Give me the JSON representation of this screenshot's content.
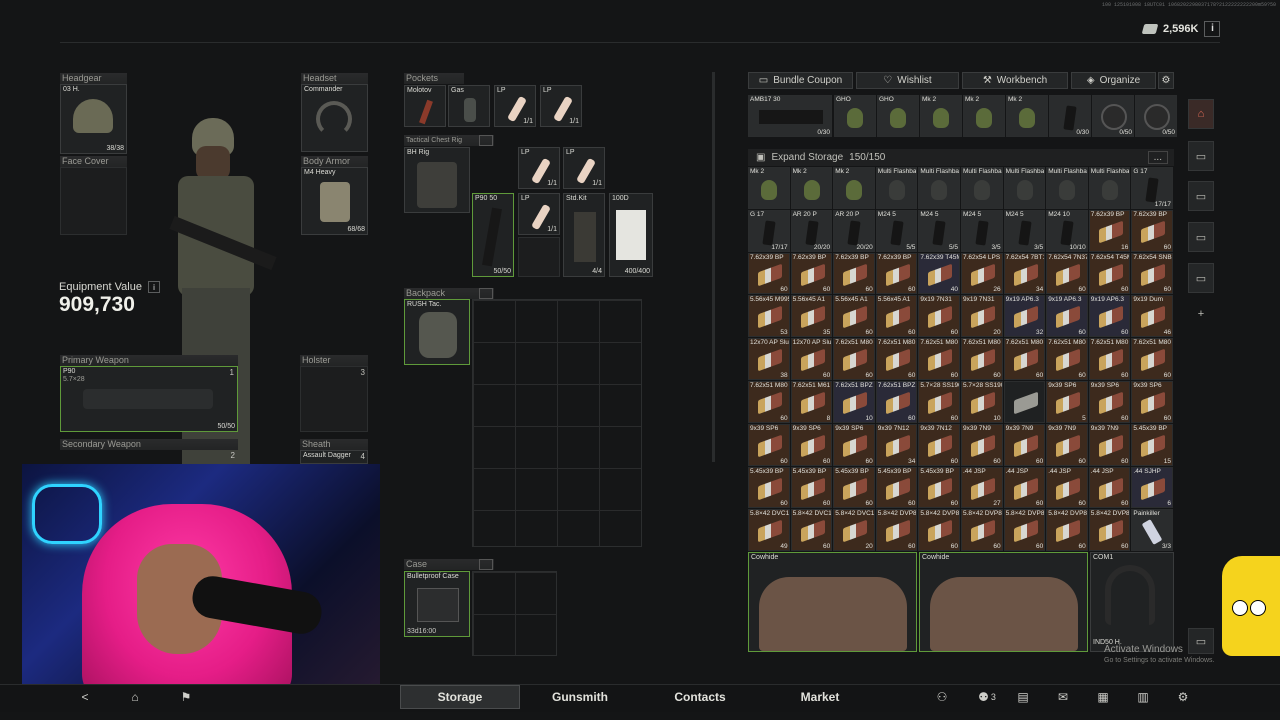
{
  "header": {
    "micro_text": "100 125101008 18UTC01 1068202298037178?2122222222200m59?50",
    "money": "2,596K",
    "info": "i"
  },
  "equipment": {
    "headgear": {
      "label": "Headgear",
      "item": "03 H.",
      "count": "38/38",
      "level": "5"
    },
    "headset": {
      "label": "Headset",
      "item": "Commander"
    },
    "face_cover": {
      "label": "Face Cover"
    },
    "body_armor": {
      "label": "Body Armor",
      "item": "M4 Heavy",
      "count": "68/68",
      "level": "5"
    },
    "value_label": "Equipment Value",
    "value": "909,730",
    "primary": {
      "label": "Primary Weapon",
      "item": "P90",
      "sub": "5.7×28",
      "count": "50/50",
      "slot": "1"
    },
    "holster": {
      "label": "Holster",
      "slot": "3"
    },
    "secondary": {
      "label": "Secondary Weapon",
      "slot": "2"
    },
    "sheath": {
      "label": "Sheath",
      "item": "Assault Dagger",
      "slot": "4"
    }
  },
  "pockets": {
    "label": "Pockets",
    "items": [
      {
        "name": "Molotov",
        "count": ""
      },
      {
        "name": "Gas",
        "count": ""
      },
      {
        "name": "LP",
        "count": "1/1"
      },
      {
        "name": "LP",
        "count": "1/1"
      }
    ]
  },
  "rig": {
    "label": "Tactical Chest Rig",
    "item": "BH Rig",
    "slots": [
      {
        "name": "LP",
        "count": "1/1"
      },
      {
        "name": "LP",
        "count": "1/1"
      },
      {
        "name": "P90 50",
        "count": "50/50"
      },
      {
        "name": "LP",
        "count": "1/1"
      },
      {
        "name": "Std.Kit",
        "count": "4/4"
      },
      {
        "name": "100D",
        "count": "400/400"
      }
    ]
  },
  "backpack": {
    "label": "Backpack",
    "item": "RUSH Tac."
  },
  "case": {
    "label": "Case",
    "item": "Bulletproof Case",
    "timer": "33d16:00"
  },
  "stash_tabs": [
    {
      "label": "Bundle Coupon",
      "icon": "coupon-icon"
    },
    {
      "label": "Wishlist",
      "icon": "heart-icon"
    },
    {
      "label": "Workbench",
      "icon": "wrench-icon"
    },
    {
      "label": "Organize",
      "icon": "organize-icon"
    }
  ],
  "top_row": [
    {
      "name": "AMB17 30",
      "count": "0/30",
      "red": true
    },
    {
      "name": "GHO",
      "count": ""
    },
    {
      "name": "GHO",
      "count": ""
    },
    {
      "name": "Mk 2",
      "count": ""
    },
    {
      "name": "Mk 2",
      "count": ""
    },
    {
      "name": "Mk 2",
      "count": ""
    },
    {
      "name": "",
      "count": "0/30",
      "red": true
    },
    {
      "name": "",
      "count": "0/50",
      "red": true
    },
    {
      "name": "",
      "count": "0/50",
      "red": true
    }
  ],
  "stash": {
    "title": "Expand Storage",
    "capacity": "150/150",
    "more": "...",
    "rows": [
      [
        {
          "n": "Mk 2",
          "c": "",
          "t": "g"
        },
        {
          "n": "Mk 2",
          "c": "",
          "t": "g"
        },
        {
          "n": "Mk 2",
          "c": "",
          "t": "g"
        },
        {
          "n": "Multi Flashbang",
          "c": "",
          "t": "f"
        },
        {
          "n": "Multi Flashbang",
          "c": "",
          "t": "f"
        },
        {
          "n": "Multi Flashbang",
          "c": "",
          "t": "f"
        },
        {
          "n": "Multi Flashbang",
          "c": "",
          "t": "f"
        },
        {
          "n": "Multi Flashbang",
          "c": "",
          "t": "f"
        },
        {
          "n": "Multi Flashbang",
          "c": "",
          "t": "f"
        },
        {
          "n": "G 17",
          "c": "17/17",
          "t": "m"
        }
      ],
      [
        {
          "n": "G 17",
          "c": "17/17",
          "t": "m"
        },
        {
          "n": "AR 20 P",
          "c": "20/20",
          "t": "m"
        },
        {
          "n": "AR 20 P",
          "c": "20/20",
          "t": "m"
        },
        {
          "n": "M24 5",
          "c": "5/5",
          "t": "m"
        },
        {
          "n": "M24 5",
          "c": "5/5",
          "t": "m"
        },
        {
          "n": "M24 5",
          "c": "3/5",
          "t": "m"
        },
        {
          "n": "M24 5",
          "c": "3/5",
          "t": "m"
        },
        {
          "n": "M24 10",
          "c": "10/10",
          "t": "m"
        },
        {
          "n": "7.62x39 BP",
          "c": "16",
          "t": "a"
        },
        {
          "n": "7.62x39 BP",
          "c": "60",
          "t": "a"
        }
      ],
      [
        {
          "n": "7.62x39 BP",
          "c": "60",
          "t": "a"
        },
        {
          "n": "7.62x39 BP",
          "c": "60",
          "t": "a"
        },
        {
          "n": "7.62x39 BP",
          "c": "60",
          "t": "a"
        },
        {
          "n": "7.62x39 BP",
          "c": "60",
          "t": "a"
        },
        {
          "n": "7.62x39 T45M",
          "c": "40",
          "t": "b"
        },
        {
          "n": "7.62x54 LPS",
          "c": "26",
          "t": "a"
        },
        {
          "n": "7.62x54 7BT1",
          "c": "34",
          "t": "a"
        },
        {
          "n": "7.62x54 7N37",
          "c": "60",
          "t": "a"
        },
        {
          "n": "7.62x54 T45M",
          "c": "60",
          "t": "a"
        },
        {
          "n": "7.62x54 SNB",
          "c": "60",
          "t": "a"
        }
      ],
      [
        {
          "n": "5.56x45 M995",
          "c": "53",
          "t": "a"
        },
        {
          "n": "5.56x45 A1",
          "c": "35",
          "t": "a"
        },
        {
          "n": "5.56x45 A1",
          "c": "60",
          "t": "a"
        },
        {
          "n": "5.56x45 A1",
          "c": "60",
          "t": "a"
        },
        {
          "n": "9x19 7N31",
          "c": "60",
          "t": "a"
        },
        {
          "n": "9x19 7N31",
          "c": "20",
          "t": "a"
        },
        {
          "n": "9x19 AP6.3",
          "c": "32",
          "t": "b"
        },
        {
          "n": "9x19 AP6.3",
          "c": "60",
          "t": "b"
        },
        {
          "n": "9x19 AP6.3",
          "c": "60",
          "t": "b"
        },
        {
          "n": "9x19 Dum",
          "c": "46",
          "t": "a"
        }
      ],
      [
        {
          "n": "12x70 AP Slugs",
          "c": "38",
          "t": "a"
        },
        {
          "n": "12x70 AP Slugs",
          "c": "60",
          "t": "a"
        },
        {
          "n": "7.62x51 M80",
          "c": "60",
          "t": "a"
        },
        {
          "n": "7.62x51 M80",
          "c": "60",
          "t": "a"
        },
        {
          "n": "7.62x51 M80",
          "c": "60",
          "t": "a"
        },
        {
          "n": "7.62x51 M80",
          "c": "60",
          "t": "a"
        },
        {
          "n": "7.62x51 M80",
          "c": "60",
          "t": "a"
        },
        {
          "n": "7.62x51 M80",
          "c": "60",
          "t": "a"
        },
        {
          "n": "7.62x51 M80",
          "c": "60",
          "t": "a"
        },
        {
          "n": "7.62x51 M80",
          "c": "60",
          "t": "a"
        }
      ],
      [
        {
          "n": "7.62x51 M80",
          "c": "60",
          "t": "a"
        },
        {
          "n": "7.62x51 M61",
          "c": "8",
          "t": "a"
        },
        {
          "n": "7.62x51 BPZ",
          "c": "10",
          "t": "b"
        },
        {
          "n": "7.62x51 BPZ",
          "c": "60",
          "t": "b"
        },
        {
          "n": "5.7×28 SS190",
          "c": "60",
          "t": "a"
        },
        {
          "n": "5.7×28 SS190",
          "c": "10",
          "t": "a"
        },
        {
          "n": "",
          "c": "",
          "t": "x"
        },
        {
          "n": "9x39 SP6",
          "c": "5",
          "t": "a"
        },
        {
          "n": "9x39 SP6",
          "c": "60",
          "t": "a"
        },
        {
          "n": "9x39 SP6",
          "c": "60",
          "t": "a"
        }
      ],
      [
        {
          "n": "9x39 SP6",
          "c": "60",
          "t": "a"
        },
        {
          "n": "9x39 SP6",
          "c": "60",
          "t": "a"
        },
        {
          "n": "9x39 SP6",
          "c": "60",
          "t": "a"
        },
        {
          "n": "9x39 7N12",
          "c": "34",
          "t": "a"
        },
        {
          "n": "9x39 7N12",
          "c": "60",
          "t": "a"
        },
        {
          "n": "9x39 7N9",
          "c": "60",
          "t": "a"
        },
        {
          "n": "9x39 7N9",
          "c": "60",
          "t": "a"
        },
        {
          "n": "9x39 7N9",
          "c": "60",
          "t": "a"
        },
        {
          "n": "9x39 7N9",
          "c": "60",
          "t": "a"
        },
        {
          "n": "5.45x39 BP",
          "c": "15",
          "t": "a"
        }
      ],
      [
        {
          "n": "5.45x39 BP",
          "c": "60",
          "t": "a"
        },
        {
          "n": "5.45x39 BP",
          "c": "60",
          "t": "a"
        },
        {
          "n": "5.45x39 BP",
          "c": "60",
          "t": "a"
        },
        {
          "n": "5.45x39 BP",
          "c": "60",
          "t": "a"
        },
        {
          "n": "5.45x39 BP",
          "c": "60",
          "t": "a"
        },
        {
          "n": ".44 JSP",
          "c": "27",
          "t": "a"
        },
        {
          "n": ".44 JSP",
          "c": "60",
          "t": "a"
        },
        {
          "n": ".44 JSP",
          "c": "60",
          "t": "a"
        },
        {
          "n": ".44 JSP",
          "c": "60",
          "t": "a"
        },
        {
          "n": ".44 SJHP",
          "c": "6",
          "t": "b"
        }
      ],
      [
        {
          "n": "5.8×42 DVC12",
          "c": "49",
          "t": "a"
        },
        {
          "n": "5.8×42 DVC12",
          "c": "60",
          "t": "a"
        },
        {
          "n": "5.8×42 DVC12",
          "c": "20",
          "t": "a"
        },
        {
          "n": "5.8×42 DVP88",
          "c": "60",
          "t": "a"
        },
        {
          "n": "5.8×42 DVP88",
          "c": "60",
          "t": "a"
        },
        {
          "n": "5.8×42 DVP88",
          "c": "60",
          "t": "a"
        },
        {
          "n": "5.8×42 DVP88",
          "c": "60",
          "t": "a"
        },
        {
          "n": "5.8×42 DVP88",
          "c": "60",
          "t": "a"
        },
        {
          "n": "5.8×42 DVP88",
          "c": "60",
          "t": "a"
        },
        {
          "n": "Painkiller",
          "c": "3/3",
          "t": "p"
        }
      ]
    ],
    "bottom_items": [
      {
        "name": "Cowhide"
      },
      {
        "name": "Cowhide"
      },
      {
        "name": "COM1",
        "sub": "IND50 H."
      }
    ]
  },
  "watermark": {
    "line1": "Activate Windows",
    "line2": "Go to Settings to activate Windows."
  },
  "nav": {
    "tabs": [
      "Storage",
      "Gunsmith",
      "Contacts",
      "Market"
    ],
    "active": "Storage",
    "team_count": "3"
  }
}
